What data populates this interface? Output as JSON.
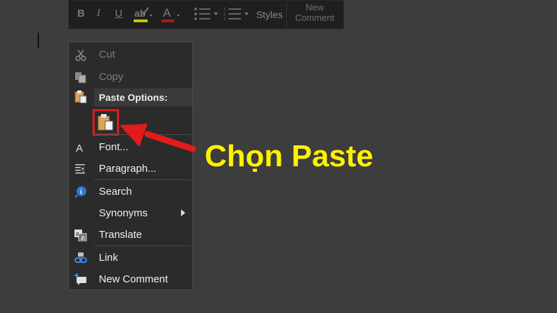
{
  "mini_toolbar": {
    "bold": "B",
    "italic": "I",
    "underline": "U",
    "styles": "Styles",
    "new_comment_line1": "New",
    "new_comment_line2": "Comment"
  },
  "context_menu": {
    "cut": "Cut",
    "copy": "Copy",
    "paste_options": "Paste Options:",
    "font": "Font...",
    "paragraph": "Paragraph...",
    "search": "Search",
    "synonyms": "Synonyms",
    "translate": "Translate",
    "link": "Link",
    "new_comment": "New Comment"
  },
  "annotation": {
    "text": "Chọn Paste",
    "color": "#fff200",
    "arrow_color": "#e21b1b"
  }
}
